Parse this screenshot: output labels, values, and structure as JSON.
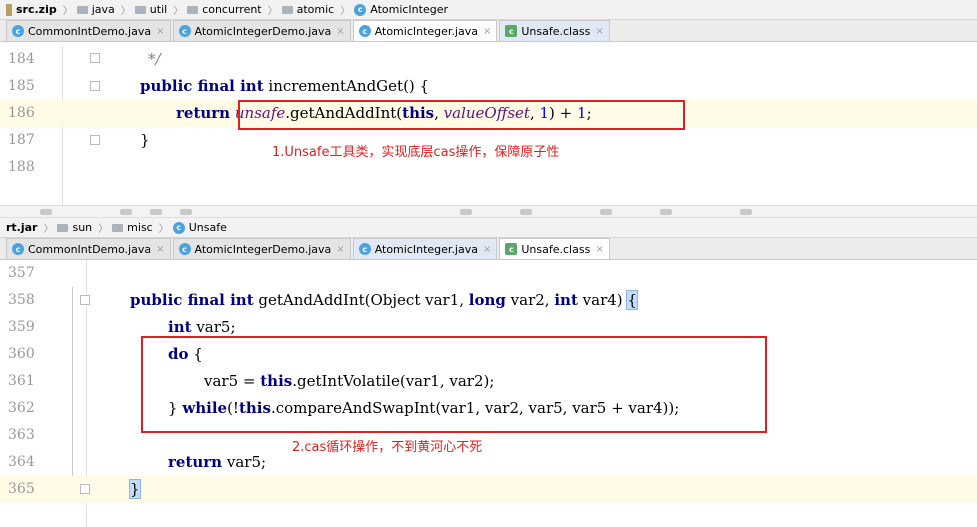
{
  "pane1": {
    "breadcrumb": [
      {
        "label": "src.zip",
        "icon": "jar-icon"
      },
      {
        "label": "java",
        "icon": "folder-icon"
      },
      {
        "label": "util",
        "icon": "folder-icon"
      },
      {
        "label": "concurrent",
        "icon": "folder-icon"
      },
      {
        "label": "atomic",
        "icon": "folder-icon"
      },
      {
        "label": "AtomicInteger",
        "icon": "class-icon"
      }
    ],
    "tabs": [
      {
        "label": "CommonIntDemo.java",
        "close": "×"
      },
      {
        "label": "AtomicIntegerDemo.java",
        "close": "×"
      },
      {
        "label": "AtomicInteger.java",
        "close": "×"
      },
      {
        "label": "Unsafe.class",
        "close": "×"
      }
    ],
    "lines": [
      {
        "n": "184",
        "text": "*/"
      },
      {
        "n": "185",
        "text": "public final int incrementAndGet() {"
      },
      {
        "n": "186",
        "text": "return unsafe.getAndAddInt(this, valueOffset, 1) + 1;"
      },
      {
        "n": "187",
        "text": "}"
      },
      {
        "n": "188",
        "text": ""
      }
    ],
    "annotation": "1.Unsafe工具类，实现底层cas操作，保障原子性"
  },
  "pane2": {
    "breadcrumb": [
      {
        "label": "rt.jar",
        "icon": "jar-icon"
      },
      {
        "label": "sun",
        "icon": "folder-icon"
      },
      {
        "label": "misc",
        "icon": "folder-icon"
      },
      {
        "label": "Unsafe",
        "icon": "class-icon"
      }
    ],
    "tabs": [
      {
        "label": "CommonIntDemo.java",
        "close": "×"
      },
      {
        "label": "AtomicIntegerDemo.java",
        "close": "×"
      },
      {
        "label": "AtomicInteger.java",
        "close": "×"
      },
      {
        "label": "Unsafe.class",
        "close": "×"
      }
    ],
    "lines": [
      {
        "n": "357",
        "text": ""
      },
      {
        "n": "358",
        "text": "public final int getAndAddInt(Object var1, long var2, int var4) {"
      },
      {
        "n": "359",
        "text": "int var5;"
      },
      {
        "n": "360",
        "text": "do {"
      },
      {
        "n": "361",
        "text": "var5 = this.getIntVolatile(var1, var2);"
      },
      {
        "n": "362",
        "text": "} while(!this.compareAndSwapInt(var1, var2, var5, var5 + var4));"
      },
      {
        "n": "363",
        "text": ""
      },
      {
        "n": "364",
        "text": "return var5;"
      },
      {
        "n": "365",
        "text": "}"
      }
    ],
    "annotation": "2.cas循环操作，不到黄河心不死"
  },
  "colors": {
    "keyword": "#000080",
    "field_italic": "#660e7a",
    "number": "#0000ff",
    "annotation_red": "#e02020",
    "current_line": "#fffbe6"
  }
}
